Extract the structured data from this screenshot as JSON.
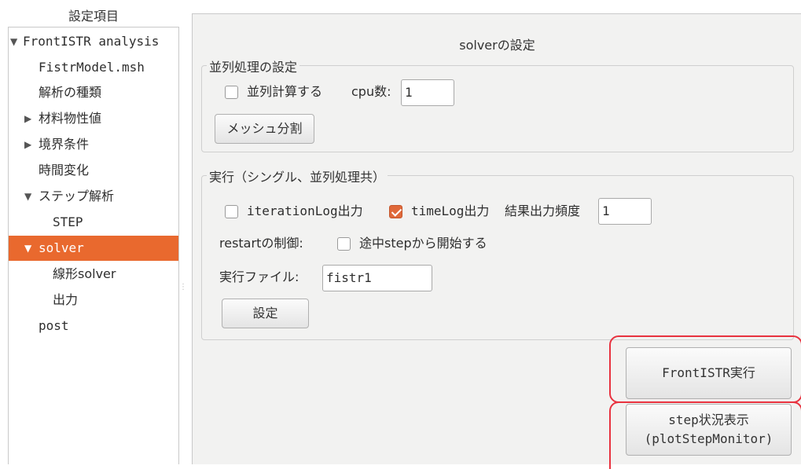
{
  "left_panel": {
    "header": "設定項目",
    "tree": [
      {
        "label": "FrontISTR analysis",
        "arrow": "▼"
      },
      {
        "label": "FistrModel.msh",
        "arrow": ""
      },
      {
        "label": "解析の種類",
        "arrow": ""
      },
      {
        "label": "材料物性値",
        "arrow": "▶"
      },
      {
        "label": "境界条件",
        "arrow": "▶"
      },
      {
        "label": "時間変化",
        "arrow": ""
      },
      {
        "label": "ステップ解析",
        "arrow": "▼"
      },
      {
        "label": "STEP",
        "arrow": ""
      },
      {
        "label": "solver",
        "arrow": "▼"
      },
      {
        "label": "線形solver",
        "arrow": ""
      },
      {
        "label": "出力",
        "arrow": ""
      },
      {
        "label": "post",
        "arrow": ""
      }
    ],
    "splitter_glyph": "⋮"
  },
  "right_panel": {
    "title": "solverの設定",
    "parallel_group": {
      "title": "並列処理の設定",
      "parallel_checkbox_label": "並列計算する",
      "parallel_checked": false,
      "cpu_label": "cpu数:",
      "cpu_value": "1",
      "mesh_split_button": "メッシュ分割"
    },
    "exec_group": {
      "title": "実行（シングル、並列処理共）",
      "iteration_log_label": "iterationLog出力",
      "iteration_log_checked": false,
      "time_log_label": "timeLog出力",
      "time_log_checked": true,
      "result_freq_label": "結果出力頻度",
      "result_freq_value": "1",
      "restart_label": "restartの制御:",
      "restart_checkbox_label": "途中stepから開始する",
      "restart_checked": false,
      "exec_file_label": "実行ファイル:",
      "exec_file_value": "fistr1",
      "set_button": "設定"
    },
    "run_button": "FrontISTR実行",
    "monitor_button_line1": "step状況表示",
    "monitor_button_line2": "(plotStepMonitor)"
  }
}
